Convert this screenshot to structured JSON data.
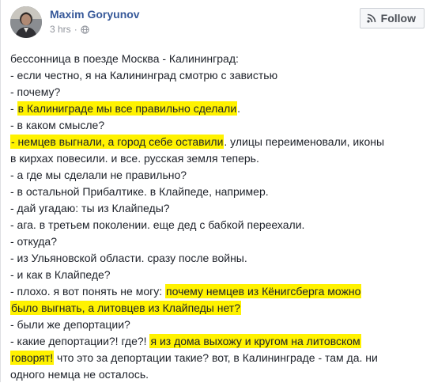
{
  "post": {
    "author": "Maxim Goryunov",
    "time": "3 hrs",
    "separator": "·",
    "privacy_icon": "globe-icon",
    "follow_label": "Follow",
    "follow_icon": "rss-icon"
  },
  "colors": {
    "author_link": "#365899",
    "highlight": "#fff200",
    "meta_text": "#90949c"
  },
  "lines": [
    [
      {
        "t": "бессонница в поезде Москва - Калининград:",
        "hl": false
      }
    ],
    [
      {
        "t": "- если честно, я на Калининград смотрю с завистью",
        "hl": false
      }
    ],
    [
      {
        "t": "- почему?",
        "hl": false
      }
    ],
    [
      {
        "t": "- ",
        "hl": false
      },
      {
        "t": "в Калиниграде мы все правильно сделали",
        "hl": true
      },
      {
        "t": ".",
        "hl": false
      }
    ],
    [
      {
        "t": "- в каком смысле?",
        "hl": false
      }
    ],
    [
      {
        "t": "- немцев выгнали, а город себе оставили",
        "hl": true
      },
      {
        "t": ". улицы переименовали, иконы",
        "hl": false
      }
    ],
    [
      {
        "t": "в кирхах повесили. и все. русская земля теперь.",
        "hl": false
      }
    ],
    [
      {
        "t": "- а где мы сделали не правильно?",
        "hl": false
      }
    ],
    [
      {
        "t": "- в остальной Прибалтике. в Клайпеде, например.",
        "hl": false
      }
    ],
    [
      {
        "t": "- дай угадаю: ты из Клайпеды?",
        "hl": false
      }
    ],
    [
      {
        "t": "- ага. в третьем поколении. еще дед с бабкой переехали.",
        "hl": false
      }
    ],
    [
      {
        "t": "- откуда?",
        "hl": false
      }
    ],
    [
      {
        "t": "- из Ульяновской области. сразу после войны.",
        "hl": false
      }
    ],
    [
      {
        "t": "- и как в Клайпеде?",
        "hl": false
      }
    ],
    [
      {
        "t": "- плохо. я вот понять не могу: ",
        "hl": false
      },
      {
        "t": "почему немцев из Кёнигсберга можно",
        "hl": true
      }
    ],
    [
      {
        "t": "было выгнать, а литовцев из Клайпеды нет?",
        "hl": true
      }
    ],
    [
      {
        "t": "- были же депортации?",
        "hl": false
      }
    ],
    [
      {
        "t": "- какие депортации?! где?! ",
        "hl": false
      },
      {
        "t": "я из дома выхожу и кругом на литовском",
        "hl": true
      }
    ],
    [
      {
        "t": "говорят!",
        "hl": true
      },
      {
        "t": " что это за депортации такие? вот, в Калининграде - там да. ни",
        "hl": false
      }
    ],
    [
      {
        "t": "одного немца не осталось.",
        "hl": false
      }
    ]
  ]
}
